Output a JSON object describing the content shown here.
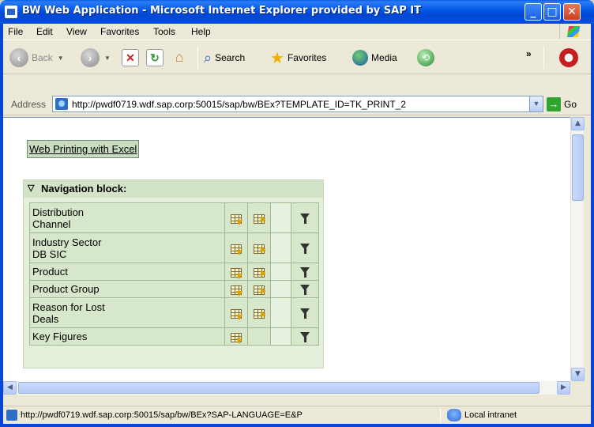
{
  "window": {
    "title": "BW Web Application - Microsoft Internet Explorer provided by SAP IT"
  },
  "menu": [
    "File",
    "Edit",
    "View",
    "Favorites",
    "Tools",
    "Help"
  ],
  "toolbar": {
    "back": "Back",
    "search": "Search",
    "favorites": "Favorites",
    "media": "Media"
  },
  "address": {
    "label": "Address",
    "url": "http://pwdf0719.wdf.sap.corp:50015/sap/bw/BEx?TEMPLATE_ID=TK_PRINT_2",
    "go": "Go"
  },
  "page": {
    "excel_link": "Web Printing with Excel",
    "nav_block": {
      "title": "Navigation block:",
      "rows": [
        {
          "line1": "Distribution",
          "line2": "Channel",
          "swap": true
        },
        {
          "line1": "Industry Sector",
          "line2": "DB SIC",
          "swap": true
        },
        {
          "line1": "Product",
          "line2": "",
          "swap": true
        },
        {
          "line1": "Product Group",
          "line2": "",
          "swap": true
        },
        {
          "line1": "Reason for Lost",
          "line2": "Deals",
          "swap": true
        },
        {
          "line1": "Key Figures",
          "line2": "",
          "swap": false
        }
      ]
    }
  },
  "status": {
    "text": "http://pwdf0719.wdf.sap.corp:50015/sap/bw/BEx?SAP-LANGUAGE=E&P",
    "zone": "Local intranet"
  }
}
